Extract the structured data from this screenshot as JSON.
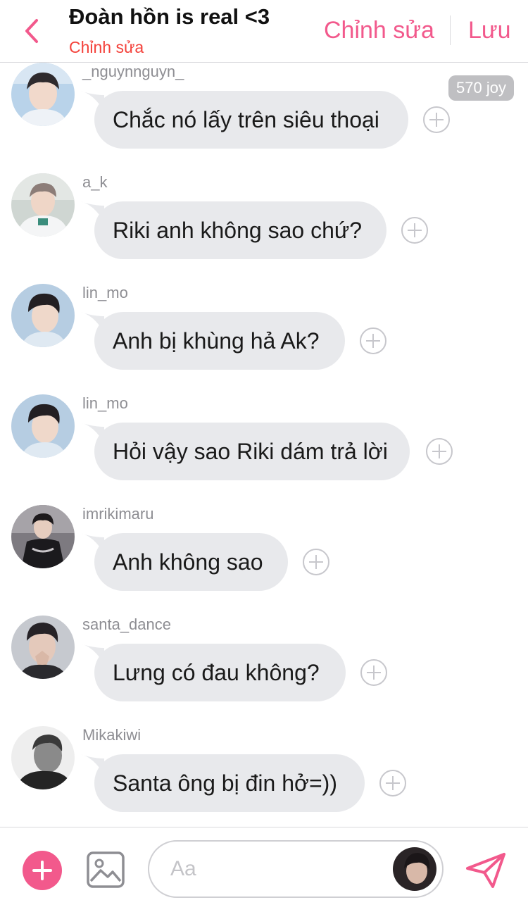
{
  "header": {
    "title": "Đoàn hồn is real <3",
    "subtitle": "Chỉnh sửa",
    "edit_label": "Chỉnh sửa",
    "save_label": "Lưu",
    "accent_color": "#f2598c"
  },
  "badge": {
    "label": "570 joy"
  },
  "messages": [
    {
      "username": "_nguynnguyn_",
      "text": "Chắc nó lấy trên siêu thoại"
    },
    {
      "username": "a_k",
      "text": "Riki anh không sao chứ?"
    },
    {
      "username": "lin_mo",
      "text": "Anh bị khùng hả Ak?"
    },
    {
      "username": "lin_mo",
      "text": "Hỏi vậy sao Riki dám trả lời"
    },
    {
      "username": "imrikimaru",
      "text": "Anh không sao"
    },
    {
      "username": "santa_dance",
      "text": "Lưng có đau không?"
    },
    {
      "username": "Mikakiwi",
      "text": "Santa ông bị đin hở=))"
    }
  ],
  "composer": {
    "placeholder": "Aa"
  },
  "icons": {
    "back": "chevron-left-icon",
    "add": "plus-icon",
    "image": "image-icon",
    "send": "send-icon",
    "react": "add-reaction-icon"
  }
}
